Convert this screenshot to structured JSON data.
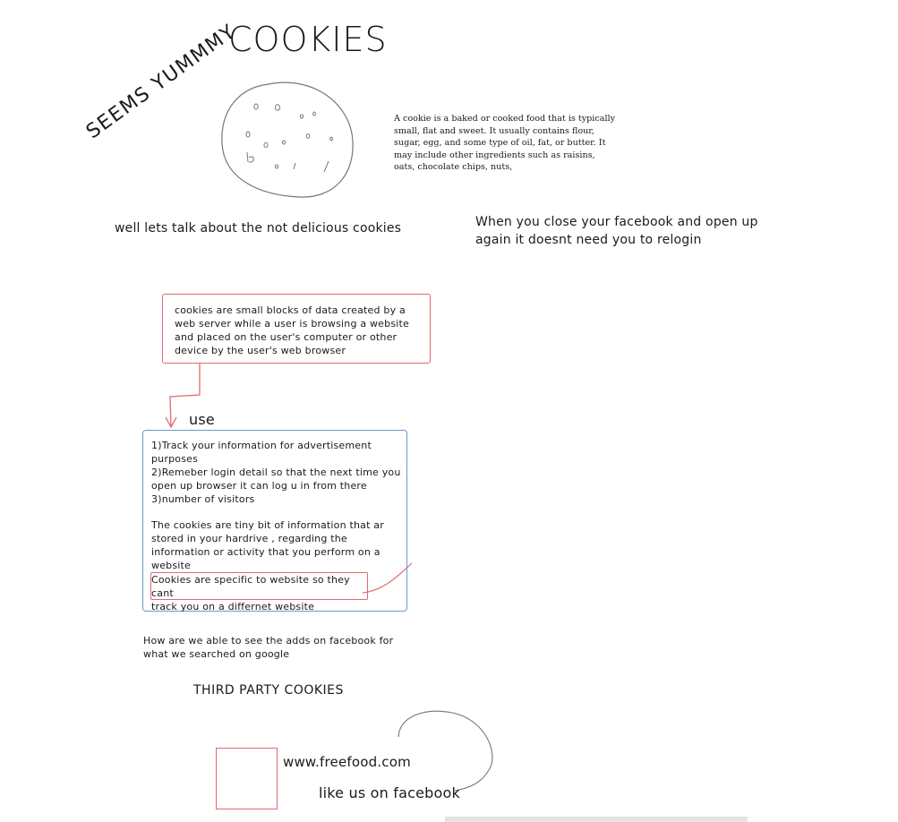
{
  "title": "COOKIES",
  "cookie_caption": "SEEMS YUMMMY",
  "cookie_definition": "A cookie is a baked or cooked food that is typically small, flat and sweet. It usually contains flour, sugar, egg, and some type of oil, fat, or butter. It may include other ingredients such as raisins, oats, chocolate chips, nuts,",
  "talk_line": "well lets talk about the not delicious cookies",
  "facebook_note": "When you close your facebook and open up again it doesnt need you to relogin",
  "definition_box": "cookies are small blocks of data created by a web server while a user is browsing a website and placed on the user's computer or other device by the user's web browser",
  "use_label": "use",
  "uses": {
    "line1": "1)Track your information for advertisement",
    "line2": "purposes",
    "line3": "2)Remeber login detail so that the next time you",
    "line4": "open up browser it can log u in from there",
    "line5": "3)number of visitors"
  },
  "tiny_info": {
    "line1": "The cookies are tiny bit of information that ar",
    "line2": "stored in your hardrive , regarding the",
    "line3": "information or activity that you perform on a",
    "line4": "website"
  },
  "specific": {
    "line1": "Cookies are specific to website so they cant",
    "line2": "track you on a differnet website"
  },
  "ads_question": {
    "line1": "How are we able to see the adds on facebook for",
    "line2": "what we searched on google"
  },
  "third_party": "THIRD PARTY COOKIES",
  "site": "www.freefood.com",
  "like": "like us on facebook",
  "colors": {
    "ink": "#1a1a1a",
    "red": "#e06a72",
    "blue": "#6a98cf",
    "sketch": "#555555"
  }
}
